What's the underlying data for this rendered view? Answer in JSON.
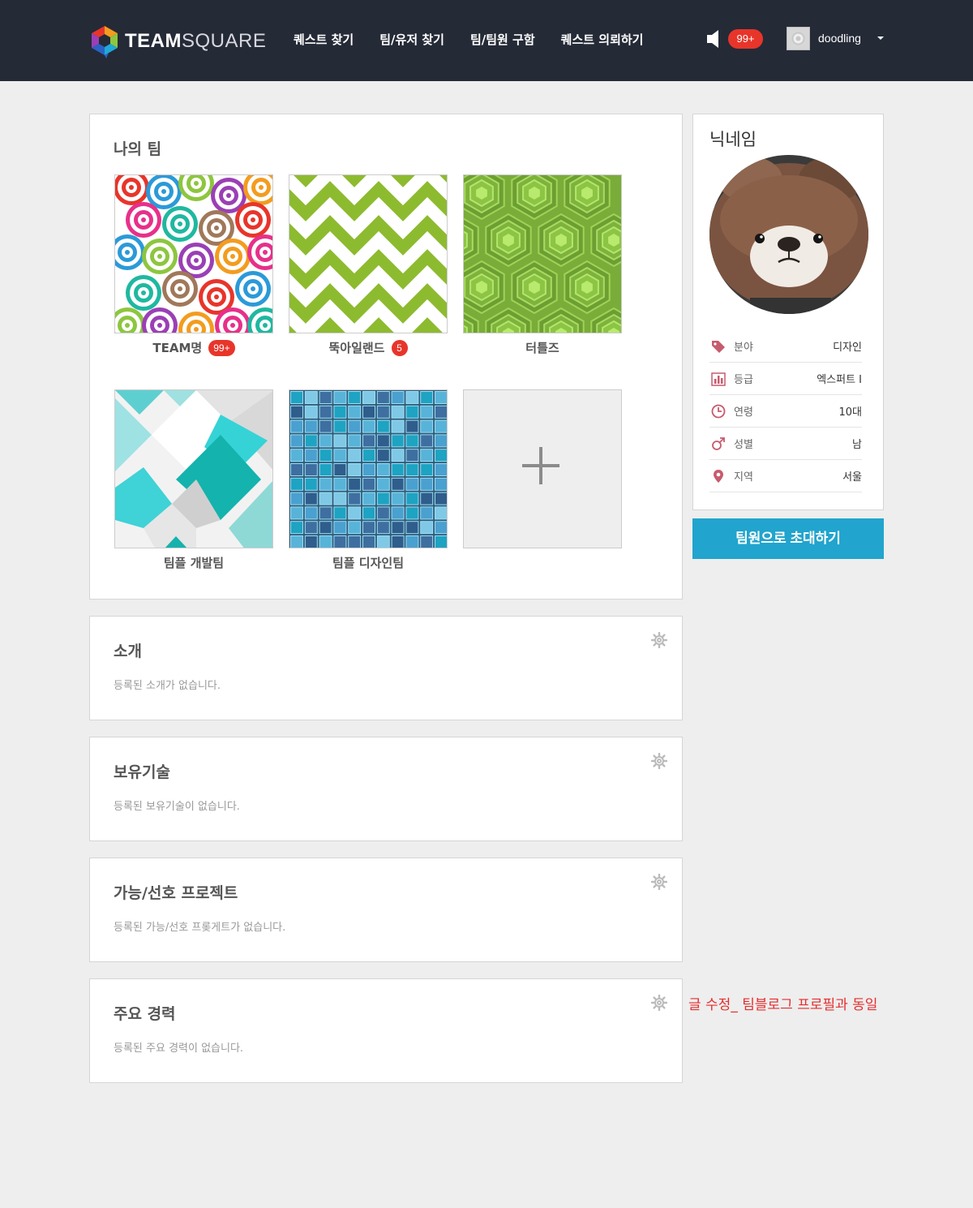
{
  "header": {
    "logo_text_bold": "TEAM",
    "logo_text_light": "SQUARE",
    "nav": [
      "퀘스트 찾기",
      "팀/유저 찾기",
      "팀/팀원 구함",
      "퀘스트 의뢰하기"
    ],
    "notification_count": "99+",
    "username": "doodling"
  },
  "my_teams": {
    "title": "나의 팀",
    "teams": [
      {
        "name": "TEAM명",
        "badge": "99+",
        "pattern": "circles"
      },
      {
        "name": "뚝아일랜드",
        "badge": "5",
        "pattern": "chevron"
      },
      {
        "name": "터틀즈",
        "badge": "",
        "pattern": "hexagon"
      },
      {
        "name": "팀플 개발팀",
        "badge": "",
        "pattern": "diamonds"
      },
      {
        "name": "팀플 디자인팀",
        "badge": "",
        "pattern": "mosaic"
      }
    ]
  },
  "sections": [
    {
      "title": "소개",
      "empty": "등록된 소개가 없습니다."
    },
    {
      "title": "보유기술",
      "empty": "등록된 보유기술이 없습니다."
    },
    {
      "title": "가능/선호 프로젝트",
      "empty": "등록된 가능/선호 프롲게트가 없습니다."
    },
    {
      "title": "주요 경력",
      "empty": "등록된 주요 경력이 없습니다."
    }
  ],
  "profile": {
    "nickname": "닉네임",
    "rows": [
      {
        "label": "분야",
        "value": "디자인",
        "icon": "tag-icon"
      },
      {
        "label": "등급",
        "value": "엑스퍼트 I",
        "icon": "bar-chart-icon"
      },
      {
        "label": "연령",
        "value": "10대",
        "icon": "clock-icon"
      },
      {
        "label": "성별",
        "value": "남",
        "icon": "male-icon"
      },
      {
        "label": "지역",
        "value": "서울",
        "icon": "map-pin-icon"
      }
    ],
    "invite_label": "팀원으로 초대하기"
  },
  "note": "글 수정_ 팀블로그 프로필과 동일",
  "colors": {
    "header_bg": "#252a37",
    "badge_red": "#e8352a",
    "invite_blue": "#21a4cd",
    "icon_pink": "#c75b6e",
    "note_red": "#e52d2d"
  }
}
